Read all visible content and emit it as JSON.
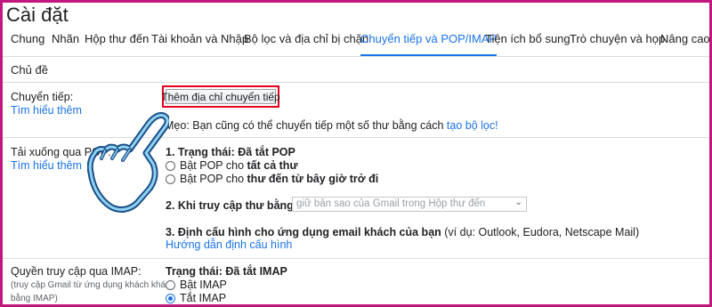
{
  "page": {
    "title": "Cài đặt"
  },
  "tabs": [
    {
      "label": "Chung",
      "active": false
    },
    {
      "label": "Nhãn",
      "active": false
    },
    {
      "label": "Hộp thư đến",
      "active": false
    },
    {
      "label": "Tài khoản và Nhập",
      "active": false
    },
    {
      "label": "Bộ lọc và địa chỉ bị chặn",
      "active": false
    },
    {
      "label": "Chuyển tiếp và POP/IMAP",
      "active": true
    },
    {
      "label": "Tiện ích bổ sung",
      "active": false
    },
    {
      "label": "Trò chuyện và họp",
      "active": false
    },
    {
      "label": "Nâng cao",
      "active": false
    },
    {
      "label": "Chủ đề",
      "active": false
    }
  ],
  "forwarding": {
    "label": "Chuyển tiếp:",
    "learn_more": "Tìm hiểu thêm",
    "add_button": "Thêm địa chỉ chuyển tiếp",
    "tip_prefix": "Mẹo: Bạn cũng có thể chuyển tiếp một số thư bằng cách ",
    "tip_link": "tạo bộ lọc!"
  },
  "pop": {
    "label": "Tải xuống qua POP:",
    "learn_more": "Tìm hiểu thêm",
    "status": "1. Trạng thái: Đã tắt POP",
    "option1_prefix": "Bật POP cho ",
    "option1_bold": "tất cả thư",
    "option2_prefix": "Bật POP cho ",
    "option2_bold": "thư đến từ bây giờ trở đi",
    "when_accessed": "2. Khi truy cập thư bằng POP",
    "when_select": "giữ bản sao của Gmail trong Hộp thư đến",
    "configure_bold": "3. Định cấu hình cho ứng dụng email khách của bạn",
    "configure_rest": " (ví dụ: Outlook, Eudora, Netscape Mail)",
    "configure_link": "Hướng dẫn định cấu hình"
  },
  "imap": {
    "label": "Quyền truy cập qua IMAP:",
    "sub1": "(truy cập Gmail từ ứng dụng khách khác",
    "sub2": "bằng IMAP)",
    "status": "Trạng thái: Đã tắt IMAP",
    "option_on": "Bật IMAP",
    "option_off": "Tắt IMAP",
    "selected": "Tắt IMAP"
  },
  "colors": {
    "accent": "#1a73e8",
    "frame": "#c2187d",
    "highlight": "#e3001b",
    "hand": "#1b4f8a"
  },
  "icons": {
    "hand": "pointing-hand-icon"
  }
}
